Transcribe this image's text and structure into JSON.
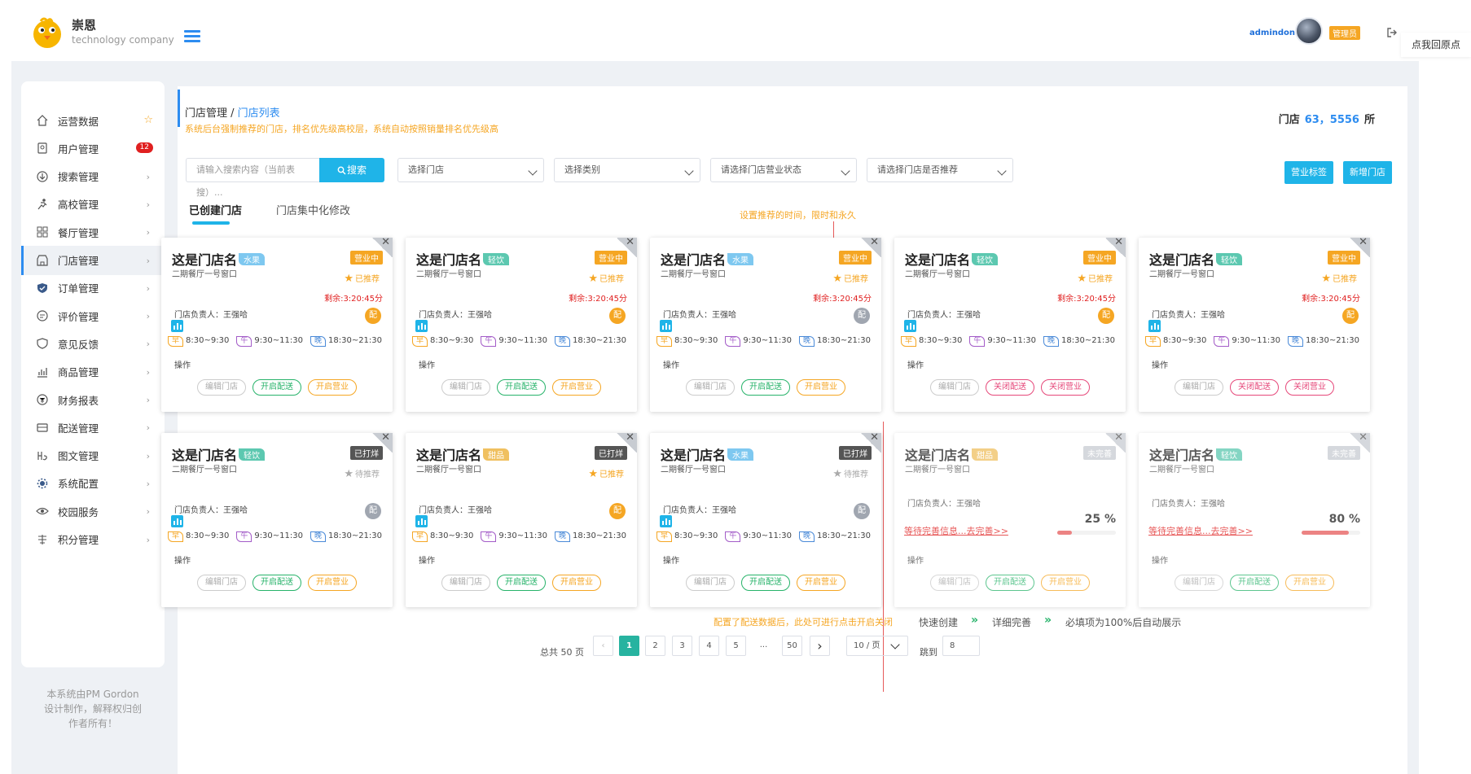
{
  "header": {
    "brand_name": "崇恩",
    "brand_sub": "technology company",
    "user": "admindon",
    "role_badge": "管理员",
    "tooltip": "点我回原点"
  },
  "sidebar": {
    "items": [
      {
        "label": "运营数据",
        "icon": "home-icon",
        "suffix": "star"
      },
      {
        "label": "用户管理",
        "icon": "user-doc-icon",
        "badge": "12"
      },
      {
        "label": "搜索管理",
        "icon": "search-download-icon",
        "suffix": "chevron"
      },
      {
        "label": "高校管理",
        "icon": "runner-icon",
        "suffix": "chevron"
      },
      {
        "label": "餐厅管理",
        "icon": "grid-icon",
        "suffix": "chevron"
      },
      {
        "label": "门店管理",
        "icon": "store-icon",
        "suffix": "chevron",
        "active": true
      },
      {
        "label": "订单管理",
        "icon": "shield-check-icon",
        "suffix": "chevron"
      },
      {
        "label": "评价管理",
        "icon": "comment-icon",
        "suffix": "chevron"
      },
      {
        "label": "意见反馈",
        "icon": "shield-icon",
        "suffix": "chevron"
      },
      {
        "label": "商品管理",
        "icon": "bar-chart-icon",
        "suffix": "chevron"
      },
      {
        "label": "财务报表",
        "icon": "finance-icon",
        "suffix": "chevron"
      },
      {
        "label": "配送管理",
        "icon": "delivery-icon",
        "suffix": "chevron"
      },
      {
        "label": "图文管理",
        "icon": "text-image-icon",
        "suffix": "chevron"
      },
      {
        "label": "系统配置",
        "icon": "gear-icon",
        "suffix": "chevron"
      },
      {
        "label": "校园服务",
        "icon": "eye-icon",
        "suffix": "chevron"
      },
      {
        "label": "积分管理",
        "icon": "list-icon",
        "suffix": "chevron"
      }
    ],
    "footer_lines": [
      "本系统由PM Gordon",
      "设计制作，解释权归创",
      "作者所有！"
    ]
  },
  "main": {
    "breadcrumb_parent": "门店管理",
    "breadcrumb_sep": " / ",
    "breadcrumb_current": "门店列表",
    "notice": "系统后台强制推荐的门店，排名优先级高校层，系统自动按照销量排名优先级高",
    "store_count_label": "门店",
    "store_count_value": "63，5556",
    "store_count_unit": "所",
    "search_placeholder": "请输入搜索内容（当前表搜）...",
    "search_button": "搜索",
    "selects": [
      "选择门店",
      "选择类别",
      "请选择门店营业状态",
      "请选择门店是否推荐"
    ],
    "btn_tag": "营业标签",
    "btn_add": "新增门店",
    "tabs": [
      "已创建门店",
      "门店集中化修改"
    ],
    "annotation_top": "设置推荐的时间，限时和永久",
    "annotation_bottom": "配置了配送数据后，此处可进行点击开启关闭",
    "flow": [
      "快速创建",
      "详细完善",
      "必填项为100%后自动展示"
    ],
    "colors": {
      "accent": "#2d8cf0",
      "cyan": "#1fb4e8",
      "orange": "#f5a623",
      "green": "#27b36a",
      "red": "#e65a5a"
    }
  },
  "card_common": {
    "sub": "二期餐厅一号窗口",
    "manager": "门店负责人：王强哈",
    "peisong": "配",
    "remain": "剩余:3:20:45分",
    "times": [
      {
        "label": "早",
        "range": "8:30~9:30"
      },
      {
        "label": "午",
        "range": "9:30~11:30"
      },
      {
        "label": "晚",
        "range": "18:30~21:30"
      }
    ],
    "op_label": "操作",
    "pending_text": "等待完善信息...去完善>>",
    "btn_edit": "编辑门店"
  },
  "cards": [
    {
      "name": "这是门店名",
      "tag": "水果",
      "tag_color": "#7ec8f0",
      "status": "营业中",
      "status_color": "#f5a623",
      "rec": "已推荐",
      "rec_on": true,
      "remain": true,
      "peisong_on": true,
      "btn2": "开启配送",
      "btn2_color": "#27b36a",
      "btn3": "开启营业",
      "btn3_color": "#f5a623"
    },
    {
      "name": "这是门店名",
      "tag": "轻饮",
      "tag_color": "#5cc8b0",
      "status": "营业中",
      "status_color": "#f5a623",
      "rec": "已推荐",
      "rec_on": true,
      "remain": true,
      "peisong_on": true,
      "btn2": "开启配送",
      "btn2_color": "#27b36a",
      "btn3": "开启营业",
      "btn3_color": "#f5a623"
    },
    {
      "name": "这是门店名",
      "tag": "水果",
      "tag_color": "#7ec8f0",
      "status": "营业中",
      "status_color": "#f5a623",
      "rec": "已推荐",
      "rec_on": true,
      "remain": true,
      "peisong_on": false,
      "btn2": "开启配送",
      "btn2_color": "#27b36a",
      "btn3": "开启营业",
      "btn3_color": "#f5a623"
    },
    {
      "name": "这是门店名",
      "tag": "轻饮",
      "tag_color": "#5cc8b0",
      "status": "营业中",
      "status_color": "#f5a623",
      "rec": "已推荐",
      "rec_on": true,
      "remain": true,
      "peisong_on": true,
      "btn2": "关闭配送",
      "btn2_color": "#e6487a",
      "btn3": "关闭营业",
      "btn3_color": "#e6487a"
    },
    {
      "name": "这是门店名",
      "tag": "轻饮",
      "tag_color": "#5cc8b0",
      "status": "营业中",
      "status_color": "#f5a623",
      "rec": "已推荐",
      "rec_on": true,
      "remain": true,
      "peisong_on": true,
      "btn2": "关闭配送",
      "btn2_color": "#e6487a",
      "btn3": "关闭营业",
      "btn3_color": "#e6487a"
    },
    {
      "name": "这是门店名",
      "tag": "轻饮",
      "tag_color": "#5cc8b0",
      "status": "已打烊",
      "status_color": "#555555",
      "rec": "待推荐",
      "rec_on": false,
      "remain": false,
      "peisong_on": false,
      "btn2": "开启配送",
      "btn2_color": "#27b36a",
      "btn3": "开启营业",
      "btn3_color": "#f5a623"
    },
    {
      "name": "这是门店名",
      "tag": "甜品",
      "tag_color": "#f0c060",
      "status": "已打烊",
      "status_color": "#555555",
      "rec": "已推荐",
      "rec_on": true,
      "remain": false,
      "peisong_on": true,
      "btn2": "开启配送",
      "btn2_color": "#27b36a",
      "btn3": "开启营业",
      "btn3_color": "#f5a623"
    },
    {
      "name": "这是门店名",
      "tag": "水果",
      "tag_color": "#7ec8f0",
      "status": "已打烊",
      "status_color": "#555555",
      "rec": "待推荐",
      "rec_on": false,
      "remain": false,
      "peisong_on": false,
      "btn2": "开启配送",
      "btn2_color": "#27b36a",
      "btn3": "开启营业",
      "btn3_color": "#f5a623"
    },
    {
      "name": "这是门店名",
      "tag": "甜品",
      "tag_color": "#f0c060",
      "status": "未完善",
      "status_color": "#c8ccd2",
      "incomplete": true,
      "progress": 0.25,
      "progress_text": "25 %",
      "btn2": "开启配送",
      "btn2_color": "#27b36a",
      "btn3": "开启营业",
      "btn3_color": "#f5a623"
    },
    {
      "name": "这是门店名",
      "tag": "轻饮",
      "tag_color": "#5cc8b0",
      "status": "未完善",
      "status_color": "#c8ccd2",
      "incomplete": true,
      "progress": 0.8,
      "progress_text": "80 %",
      "btn2": "开启配送",
      "btn2_color": "#27b36a",
      "btn3": "开启营业",
      "btn3_color": "#f5a623"
    }
  ],
  "pager": {
    "total": "总共 50 页",
    "pages": [
      "1",
      "2",
      "3",
      "4",
      "5",
      "...",
      "50"
    ],
    "current": "1",
    "page_size": "10 / 页",
    "goto_label": "跳到",
    "goto_value": "8"
  }
}
